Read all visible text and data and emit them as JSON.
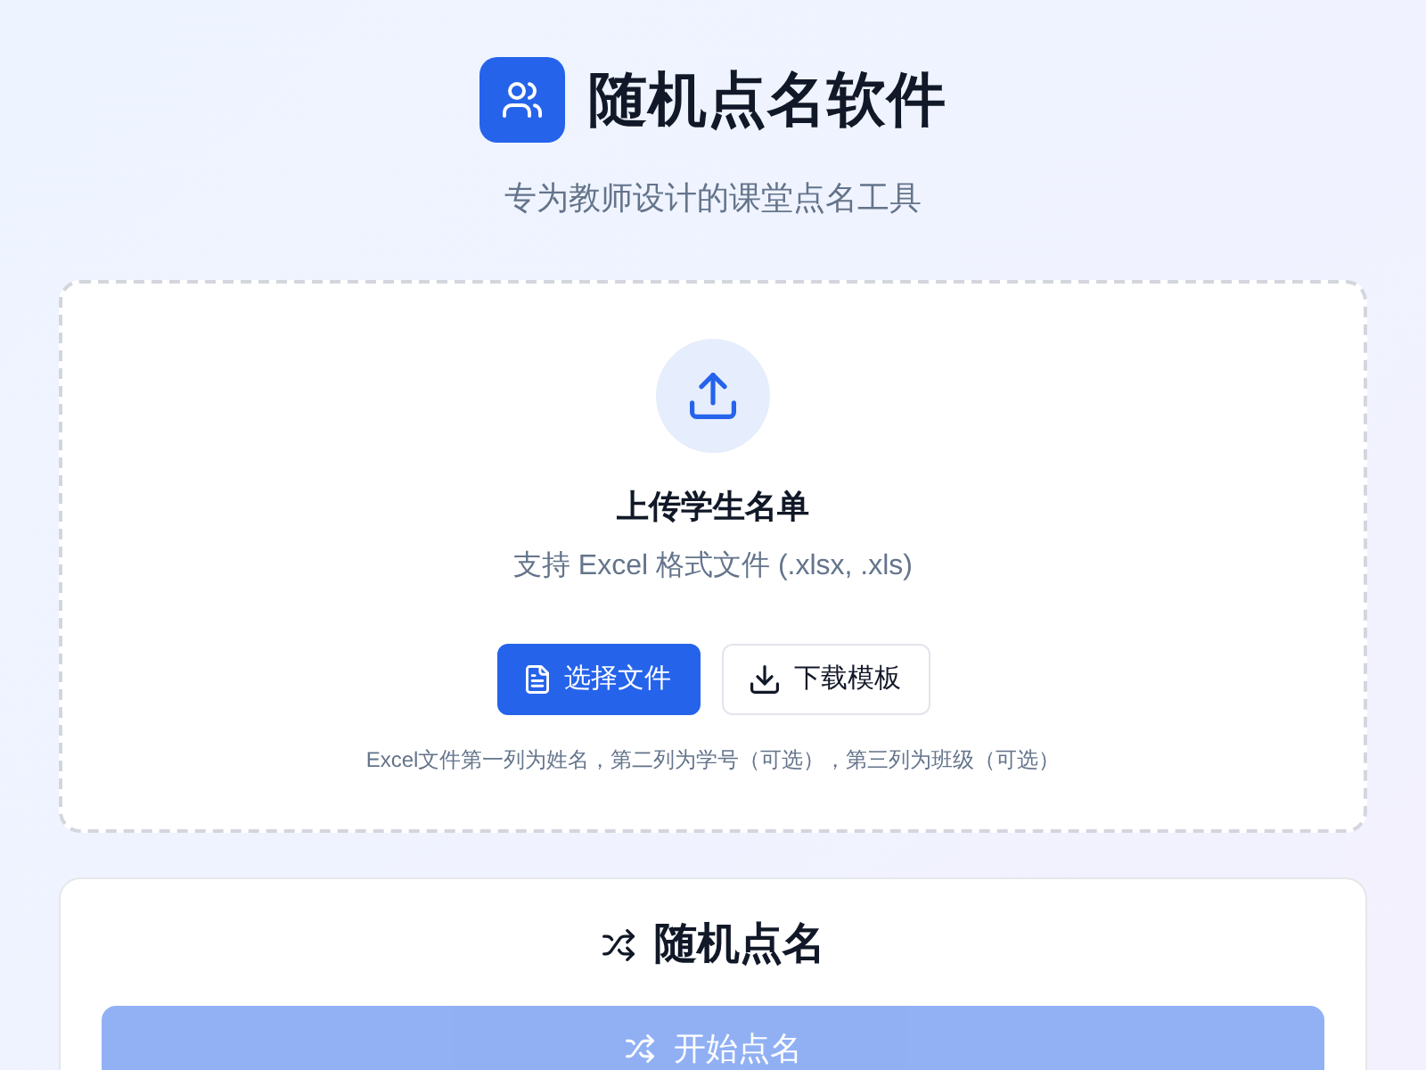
{
  "header": {
    "title": "随机点名软件",
    "subtitle": "专为教师设计的课堂点名工具"
  },
  "upload": {
    "title": "上传学生名单",
    "description": "支持 Excel 格式文件 (.xlsx, .xls)",
    "buttons": [
      {
        "label": "选择文件",
        "kind": "primary"
      },
      {
        "label": "下载模板",
        "kind": "outline"
      }
    ],
    "hint": "Excel文件第一列为姓名，第二列为学号（可选），第三列为班级（可选）"
  },
  "roll_call": {
    "title": "随机点名",
    "button": {
      "label": "开始点名",
      "disabled": true
    }
  }
}
